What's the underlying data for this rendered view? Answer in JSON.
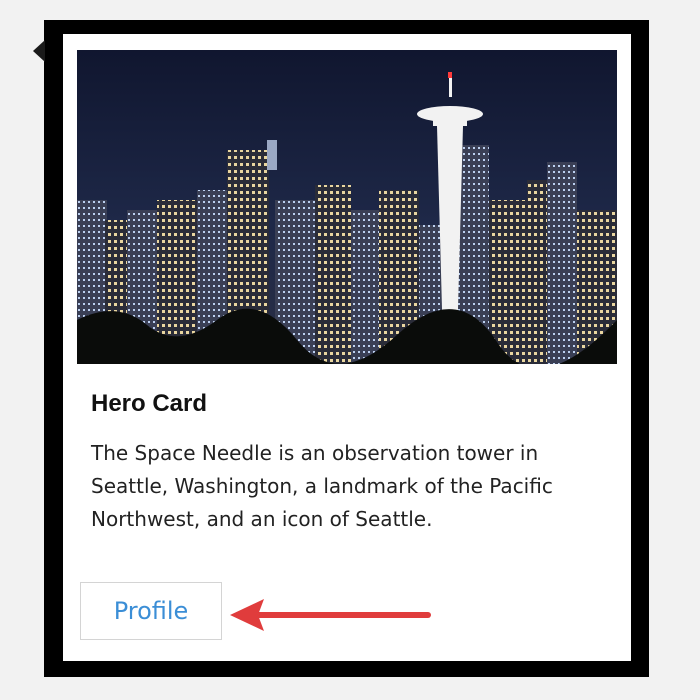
{
  "card": {
    "title": "Hero Card",
    "description": "The Space Needle is an observation tower in Seattle, Washington, a landmark of the Pacific Northwest, and an icon of Seattle.",
    "image_icon": "seattle-skyline-photo",
    "button_label": "Profile"
  },
  "colors": {
    "frame": "#000000",
    "button_text": "#3b8ed6",
    "annotation_arrow": "#e03c3c"
  }
}
